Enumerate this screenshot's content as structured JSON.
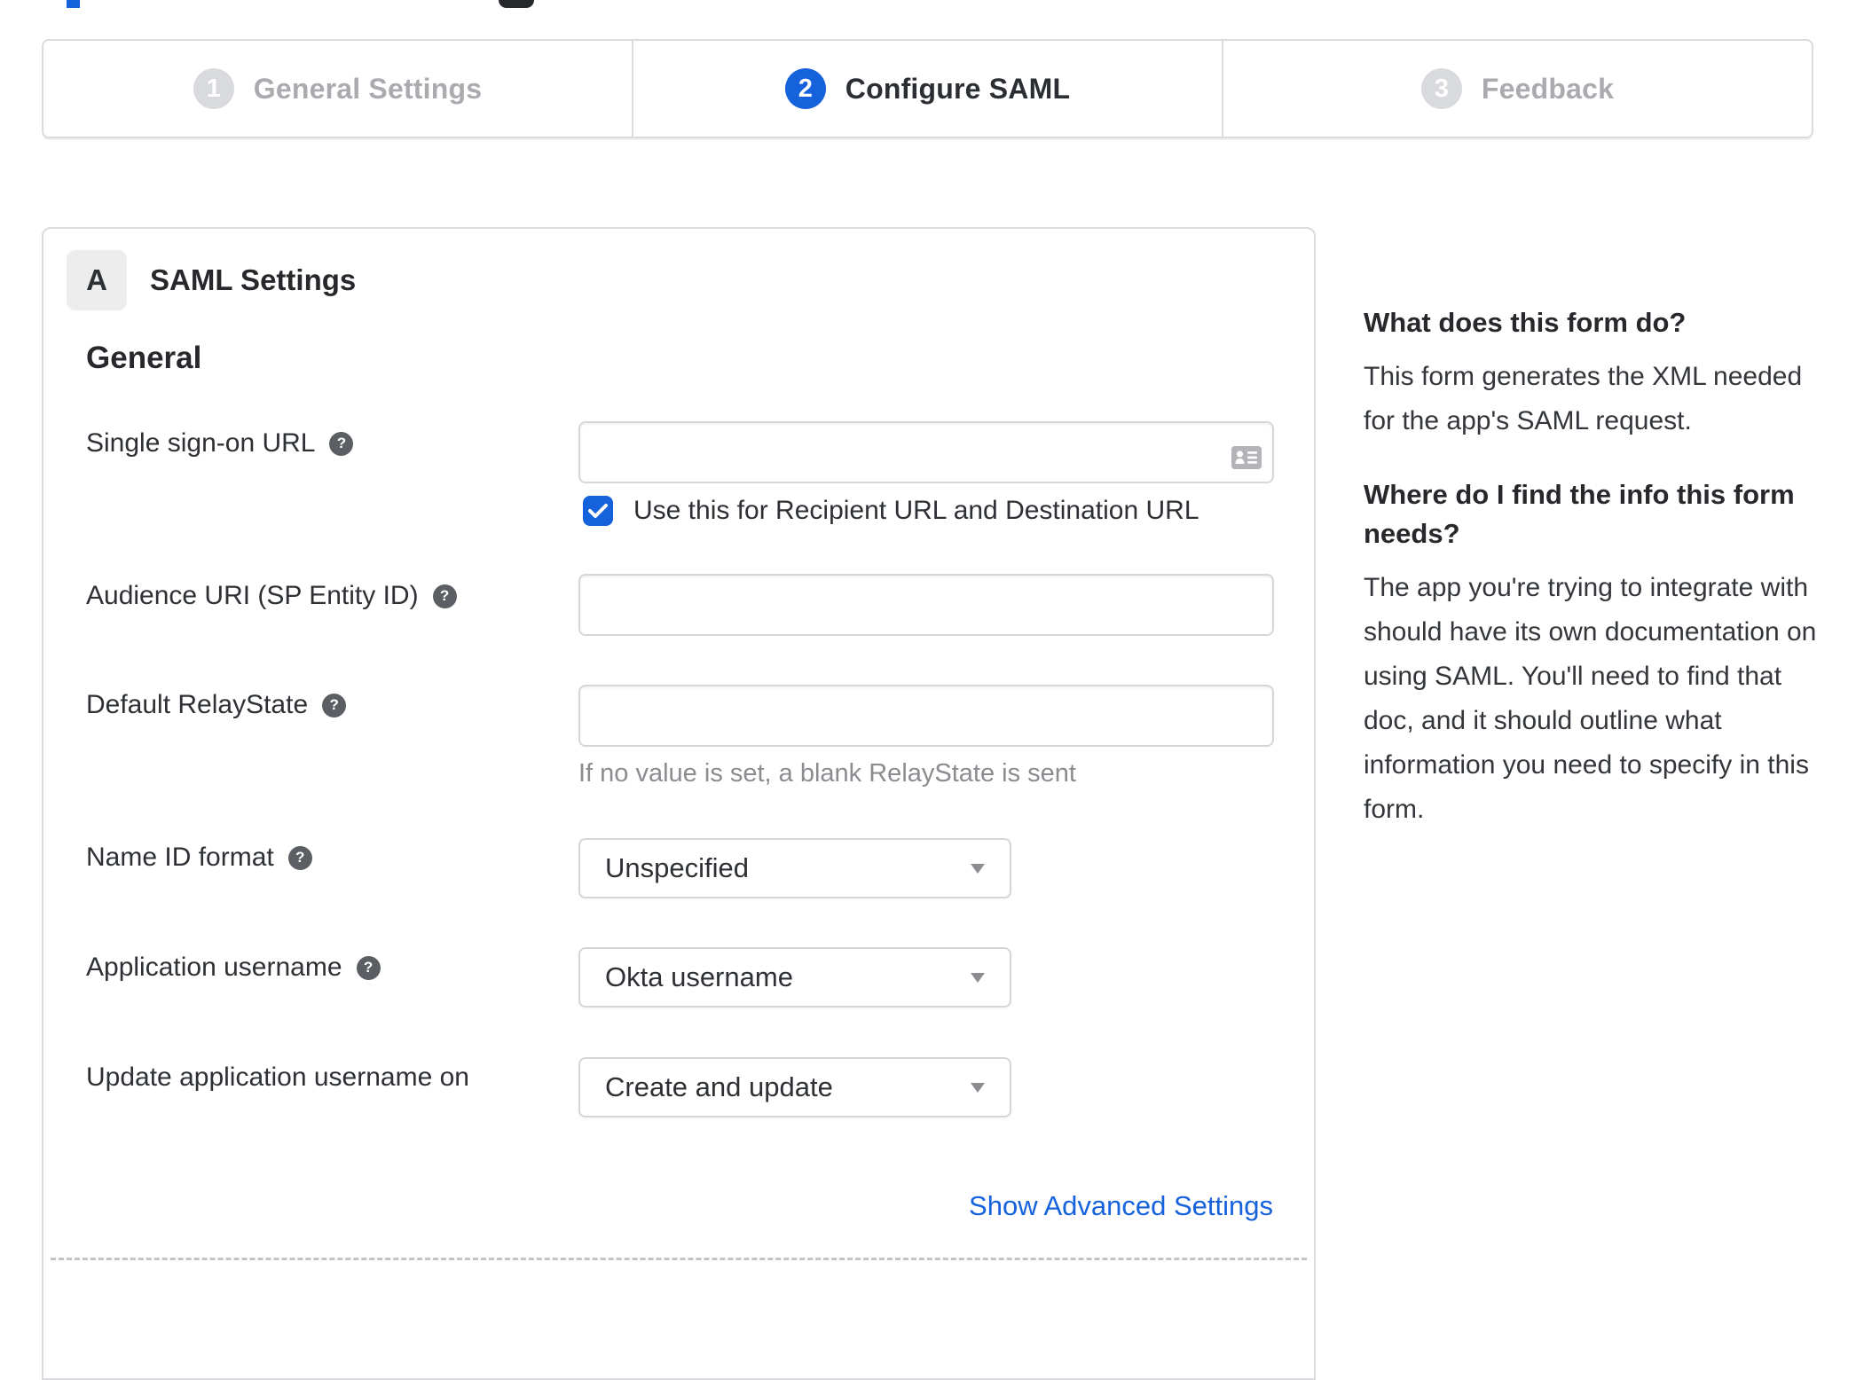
{
  "colors": {
    "accent": "#1662dd",
    "inactive_step": "#d9dadd",
    "link": "#1662dd"
  },
  "stepper": {
    "steps": [
      {
        "number": "1",
        "label": "General Settings",
        "state": "inactive"
      },
      {
        "number": "2",
        "label": "Configure SAML",
        "state": "active"
      },
      {
        "number": "3",
        "label": "Feedback",
        "state": "inactive"
      }
    ]
  },
  "panel": {
    "badge": "A",
    "title": "SAML Settings",
    "section": "General",
    "sso": {
      "label": "Single sign-on URL",
      "value": "",
      "checkbox_label": "Use this for Recipient URL and Destination URL",
      "checkbox_checked": true
    },
    "audience": {
      "label": "Audience URI (SP Entity ID)",
      "value": ""
    },
    "relay": {
      "label": "Default RelayState",
      "value": "",
      "hint": "If no value is set, a blank RelayState is sent"
    },
    "nameid": {
      "label": "Name ID format",
      "value": "Unspecified"
    },
    "appuser": {
      "label": "Application username",
      "value": "Okta username"
    },
    "updateuser": {
      "label": "Update application username on",
      "value": "Create and update"
    },
    "advanced_link": "Show Advanced Settings"
  },
  "icons": {
    "help": "?"
  },
  "sidebar": {
    "q1": "What does this form do?",
    "a1": "This form generates the XML needed for the app's SAML request.",
    "q2": "Where do I find the info this form needs?",
    "a2": "The app you're trying to integrate with should have its own documentation on using SAML. You'll need to find that doc, and it should outline what information you need to specify in this form."
  }
}
